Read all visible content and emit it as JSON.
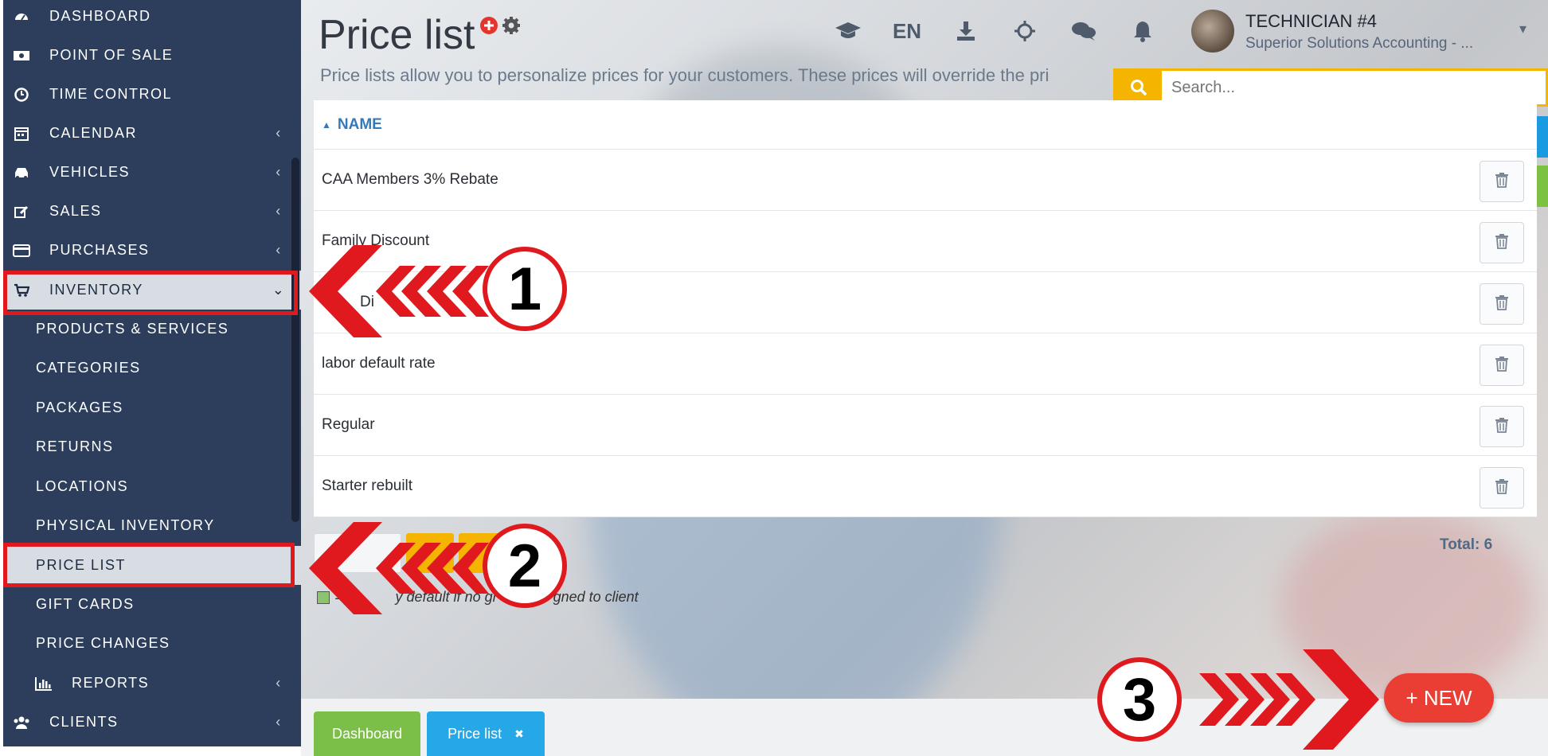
{
  "sidebar": {
    "items": [
      {
        "label": "DASHBOARD",
        "icon": "dashboard-icon"
      },
      {
        "label": "POINT OF SALE",
        "icon": "money-icon"
      },
      {
        "label": "TIME CONTROL",
        "icon": "clock-icon"
      },
      {
        "label": "CALENDAR",
        "icon": "calendar-icon",
        "chevron": "‹"
      },
      {
        "label": "VEHICLES",
        "icon": "car-icon",
        "chevron": "‹"
      },
      {
        "label": "SALES",
        "icon": "edit-icon",
        "chevron": "‹"
      },
      {
        "label": "PURCHASES",
        "icon": "credit-card-icon",
        "chevron": "‹"
      },
      {
        "label": "INVENTORY",
        "icon": "cart-icon",
        "chevron": "⌄"
      }
    ],
    "sub_items": [
      "PRODUCTS & SERVICES",
      "CATEGORIES",
      "PACKAGES",
      "RETURNS",
      "LOCATIONS",
      "PHYSICAL INVENTORY",
      "PRICE LIST",
      "GIFT CARDS",
      "PRICE CHANGES"
    ],
    "reports": {
      "label": "REPORTS",
      "icon": "bar-chart-icon",
      "chevron": "‹"
    },
    "clients": {
      "label": "CLIENTS",
      "icon": "users-icon",
      "chevron": "‹"
    }
  },
  "header": {
    "title": "Price list",
    "subtitle": "Price lists allow you to personalize prices for your customers. These prices will override the pri",
    "language": "EN",
    "icons": [
      "graduation-cap-icon",
      "language-label",
      "download-icon",
      "settings-sun-icon",
      "chat-icon",
      "bell-icon"
    ]
  },
  "user": {
    "name": "TECHNICIAN #4",
    "company": "Superior Solutions Accounting - ..."
  },
  "search": {
    "placeholder": "Search..."
  },
  "table": {
    "column_header": "NAME",
    "sort_indicator": "▲",
    "rows": [
      "CAA Members 3% Rebate",
      "Family Discount",
      "",
      "labor default rate",
      "Regular",
      "Starter rebuilt"
    ],
    "partial_row_text": "Di"
  },
  "total": "Total: 6",
  "legend": {
    "text": "= ... y default if no gr... gned to client",
    "visible_text_left": "= ",
    "visible_text_right": "y default if no gr",
    "visible_text_end": "gned to client"
  },
  "footer_tabs": {
    "dashboard": "Dashboard",
    "price_list": "Price list",
    "close": "✖"
  },
  "new_button": {
    "label": "+ NEW"
  },
  "annotations": [
    "1",
    "2",
    "3"
  ],
  "colors": {
    "sidebar_bg": "#2c3e5c",
    "accent_red": "#e0191f",
    "search_yellow": "#f4b400",
    "filter_blue": "#1a9ae0",
    "help_green": "#7cc142",
    "tab_green": "#7cbf48",
    "tab_blue": "#25a7e8",
    "link_blue": "#3579b8",
    "new_red": "#ea3d33"
  }
}
